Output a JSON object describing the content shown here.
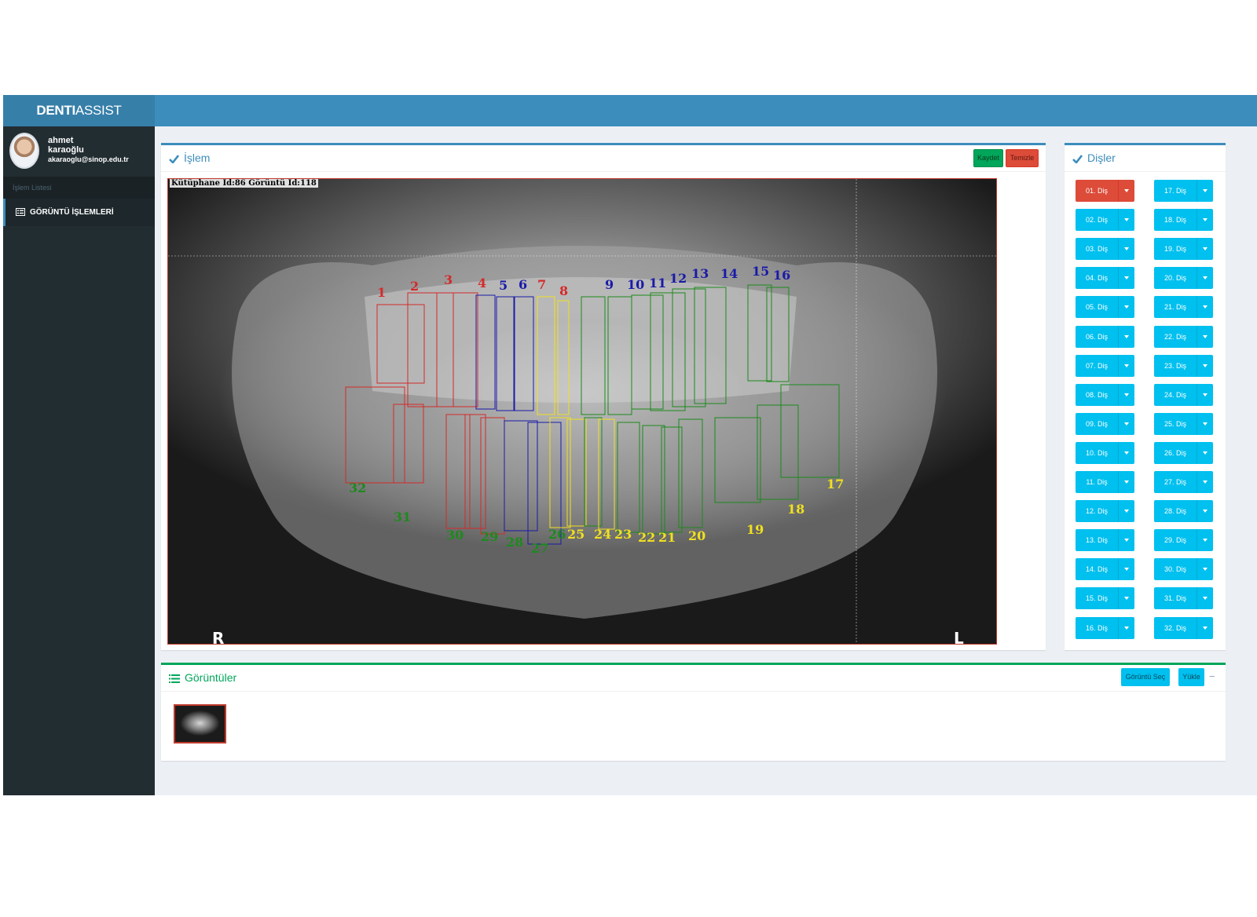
{
  "app": {
    "logo_bold": "DENTI",
    "logo_rest": "ASSIST"
  },
  "user": {
    "first_name": "ahmet",
    "last_name": "karaoğlu",
    "email": "akaraoglu@sinop.edu.tr"
  },
  "sidebar": {
    "header": "İşlem Listesi",
    "items": [
      {
        "label": "GÖRÜNTÜ İŞLEMLERİ",
        "icon": "image-list-icon"
      }
    ]
  },
  "islem": {
    "title": "İşlem",
    "save_label": "Kaydet",
    "clear_label": "Temizle",
    "caption": "Kütüphane Id:86 Görüntü Id:118",
    "side_left": "R",
    "side_right": "L",
    "tooth_labels": [
      "1",
      "2",
      "3",
      "4",
      "5",
      "6",
      "7",
      "8",
      "9",
      "10",
      "11",
      "12",
      "13",
      "14",
      "15",
      "16",
      "17",
      "18",
      "19",
      "20",
      "21",
      "22",
      "23",
      "24",
      "25",
      "26",
      "27",
      "28",
      "29",
      "30",
      "31",
      "32"
    ],
    "label_colors": {
      "red": "#d42a2a",
      "blue": "#1a1aa8",
      "yellow": "#f0e020",
      "green": "#1c8a1c"
    }
  },
  "disler": {
    "title": "Dişler",
    "active": "01. Diş",
    "left_column": [
      "01. Diş",
      "02. Diş",
      "03. Diş",
      "04. Diş",
      "05. Diş",
      "06. Diş",
      "07. Diş",
      "08. Diş",
      "09. Diş",
      "10. Diş",
      "11. Diş",
      "12. Diş",
      "13. Diş",
      "14. Diş",
      "15. Diş",
      "16. Diş"
    ],
    "right_column": [
      "17. Diş",
      "18. Diş",
      "19. Diş",
      "20. Diş",
      "21. Diş",
      "22. Diş",
      "23. Diş",
      "24. Diş",
      "25. Diş",
      "26. Diş",
      "27. Diş",
      "28. Diş",
      "29. Diş",
      "30. Diş",
      "31. Diş",
      "32. Diş"
    ]
  },
  "goruntuler": {
    "title": "Görüntüler",
    "select_label": "Görüntü Seç",
    "upload_label": "Yükle",
    "collapse_label": "−"
  },
  "colors": {
    "header": "#3c8dbc",
    "logo_bg": "#367fa9",
    "sidebar": "#222d32",
    "info": "#00c0ef",
    "success": "#00a65a",
    "danger": "#dd4b39"
  }
}
